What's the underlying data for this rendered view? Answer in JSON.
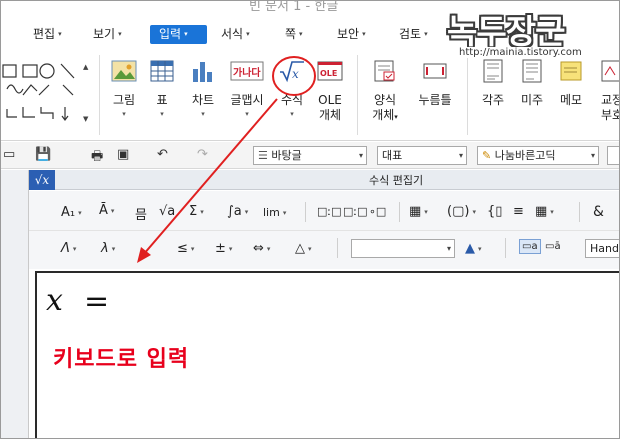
{
  "window": {
    "title": "빈 문서 1 - 한글"
  },
  "menu": [
    {
      "label": "편집",
      "active": false
    },
    {
      "label": "보기",
      "active": false
    },
    {
      "label": "입력",
      "active": true
    },
    {
      "label": "서식",
      "active": false
    },
    {
      "label": "쪽",
      "active": false
    },
    {
      "label": "보안",
      "active": false
    },
    {
      "label": "검토",
      "active": false
    }
  ],
  "watermark": {
    "title": "녹두장군",
    "url": "http://mainia.tistory.com"
  },
  "ribbon": {
    "picture": "그림",
    "table": "표",
    "chart": "차트",
    "wordart": "글맵시",
    "equation": "수식",
    "ole": {
      "line1": "OLE",
      "line2": "개체"
    },
    "form": {
      "line1": "양식",
      "line2": "개체"
    },
    "clicktext": "누름틀",
    "footnote": "각주",
    "endnote": "미주",
    "memo": "메모",
    "proof": {
      "line1": "교정",
      "line2": "부호"
    }
  },
  "toolbar2": {
    "style": "바탕글",
    "lang": "대표",
    "font": "나눔바른고딕"
  },
  "equation_editor": {
    "title": "수식 편집기",
    "badge": "√x",
    "row1": {
      "subsup": "A₁",
      "decor": "Ā",
      "fraction": "믐",
      "root": "√",
      "sum": "Σ",
      "integral": "∫",
      "limit": "lim",
      "amp": "&"
    },
    "row2": {
      "greek_upper": "Λ",
      "greek_lower": "λ",
      "le": "≤",
      "pm": "±",
      "arrow": "⇔",
      "triangle": "△",
      "font_select": "Hand"
    },
    "formula_var": "x",
    "formula_eq": "="
  },
  "annotation": "키보드로 입력",
  "colors": {
    "accent": "#1a74d8",
    "annotation": "#e8001c",
    "highlight_circle": "#e02020"
  }
}
